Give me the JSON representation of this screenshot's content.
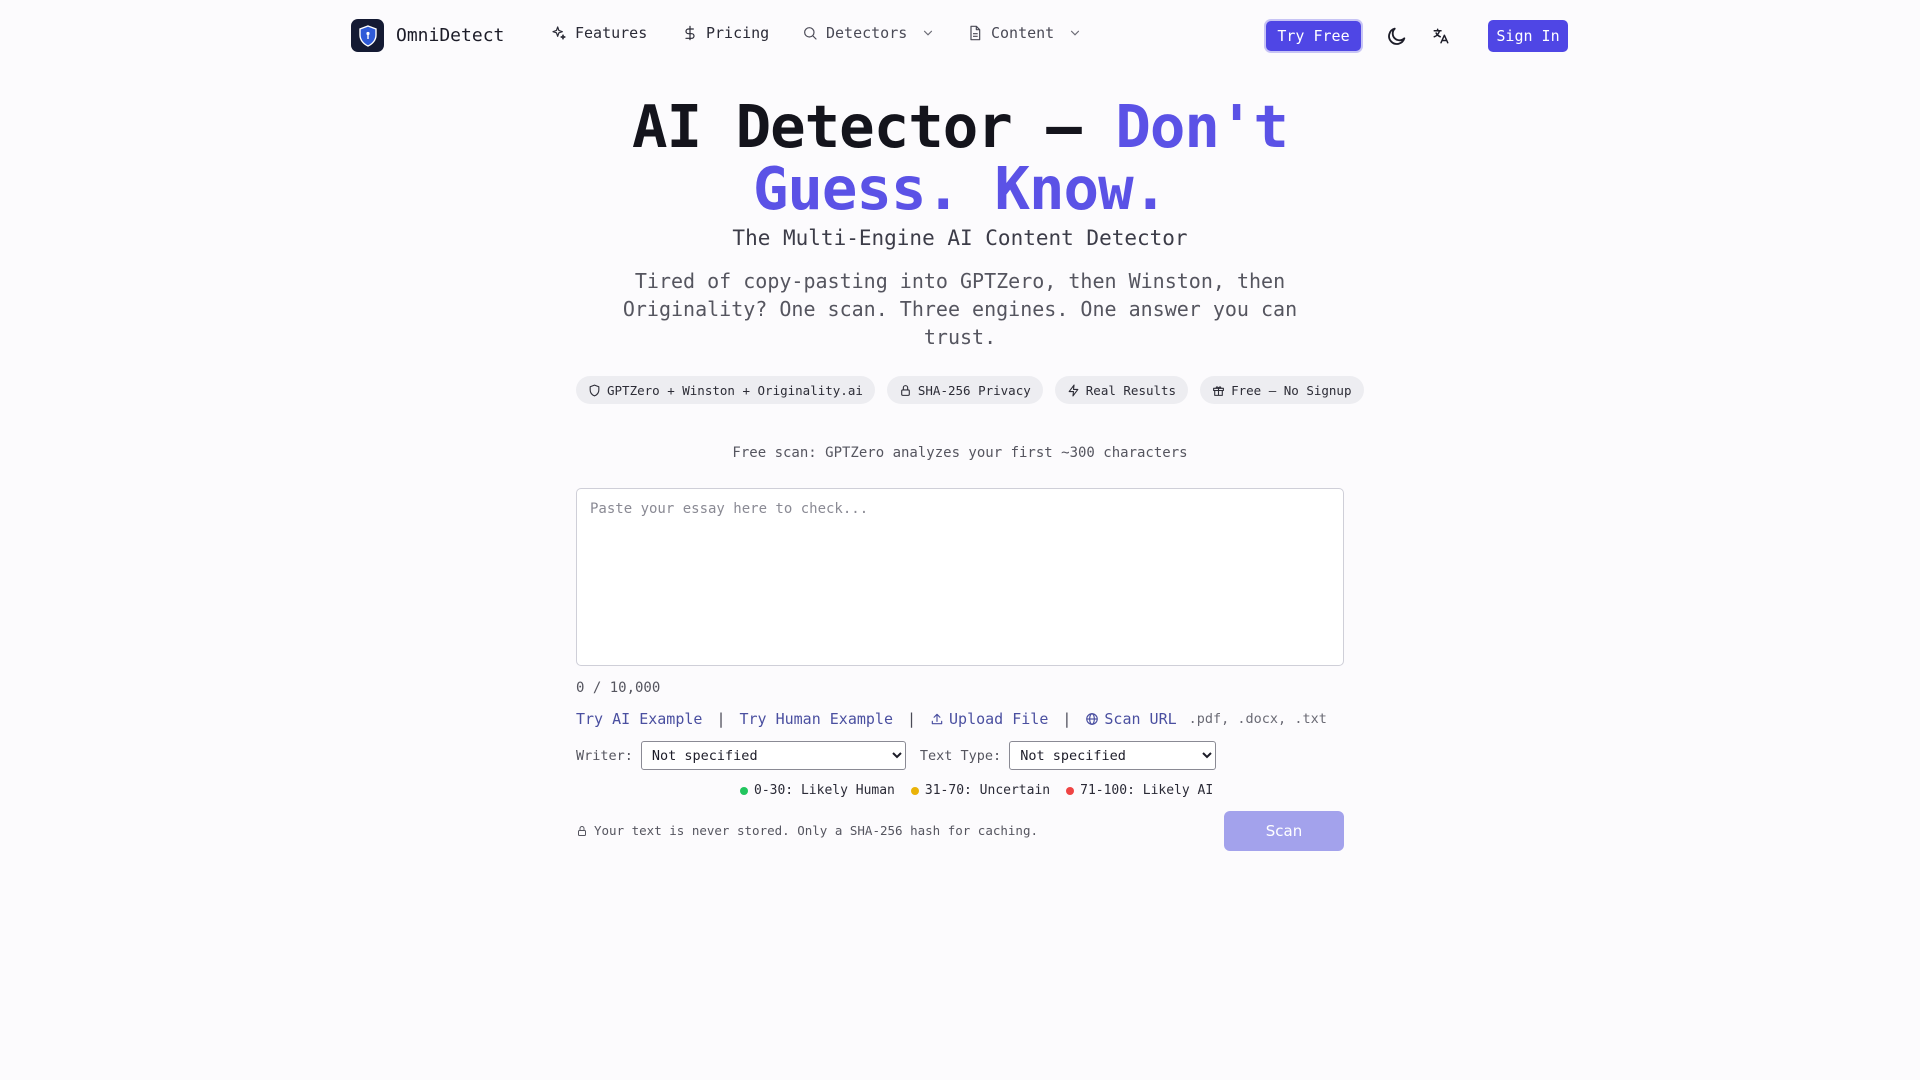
{
  "nav": {
    "brand": "OmniDetect",
    "features": "Features",
    "pricing": "Pricing",
    "detectors": "Detectors",
    "content": "Content",
    "try_free": "Try Free",
    "sign_in": "Sign In"
  },
  "hero": {
    "title_main": "AI Detector — ",
    "title_accent": "Don't Guess. Know.",
    "subtitle": "The Multi-Engine AI Content Detector",
    "description": "Tired of copy-pasting into GPTZero, then Winston, then Originality? One scan. Three engines. One answer you can trust."
  },
  "badges": [
    {
      "label": "GPTZero + Winston + Originality.ai",
      "icon": "shield-icon"
    },
    {
      "label": "SHA-256 Privacy",
      "icon": "lock-icon"
    },
    {
      "label": "Real Results",
      "icon": "bolt-icon"
    },
    {
      "label": "Free — No Signup",
      "icon": "gift-icon"
    }
  ],
  "scanner": {
    "free_note": "Free scan: GPTZero analyzes your first ~300 characters",
    "placeholder": "Paste your essay here to check...",
    "counter": "0 / 10,000",
    "try_ai": "Try AI Example",
    "try_human": "Try Human Example",
    "upload": "Upload File",
    "scan_url": "Scan URL",
    "extensions": ".pdf, .docx, .txt",
    "separator": "|",
    "writer_label": "Writer:",
    "writer_value": "Not specified",
    "text_type_label": "Text Type:",
    "text_type_value": "Not specified",
    "legend": [
      {
        "label": "0-30: Likely Human",
        "color": "#22c55e"
      },
      {
        "label": "31-70: Uncertain",
        "color": "#eab308"
      },
      {
        "label": "71-100: Likely AI",
        "color": "#ef4444"
      }
    ],
    "privacy_note": "Your text is never stored. Only a SHA-256 hash for caching.",
    "scan_button": "Scan"
  },
  "colors": {
    "accent": "#5b52e6",
    "primary_button": "#4f46e5",
    "scan_button_disabled": "#a3a2ec"
  }
}
